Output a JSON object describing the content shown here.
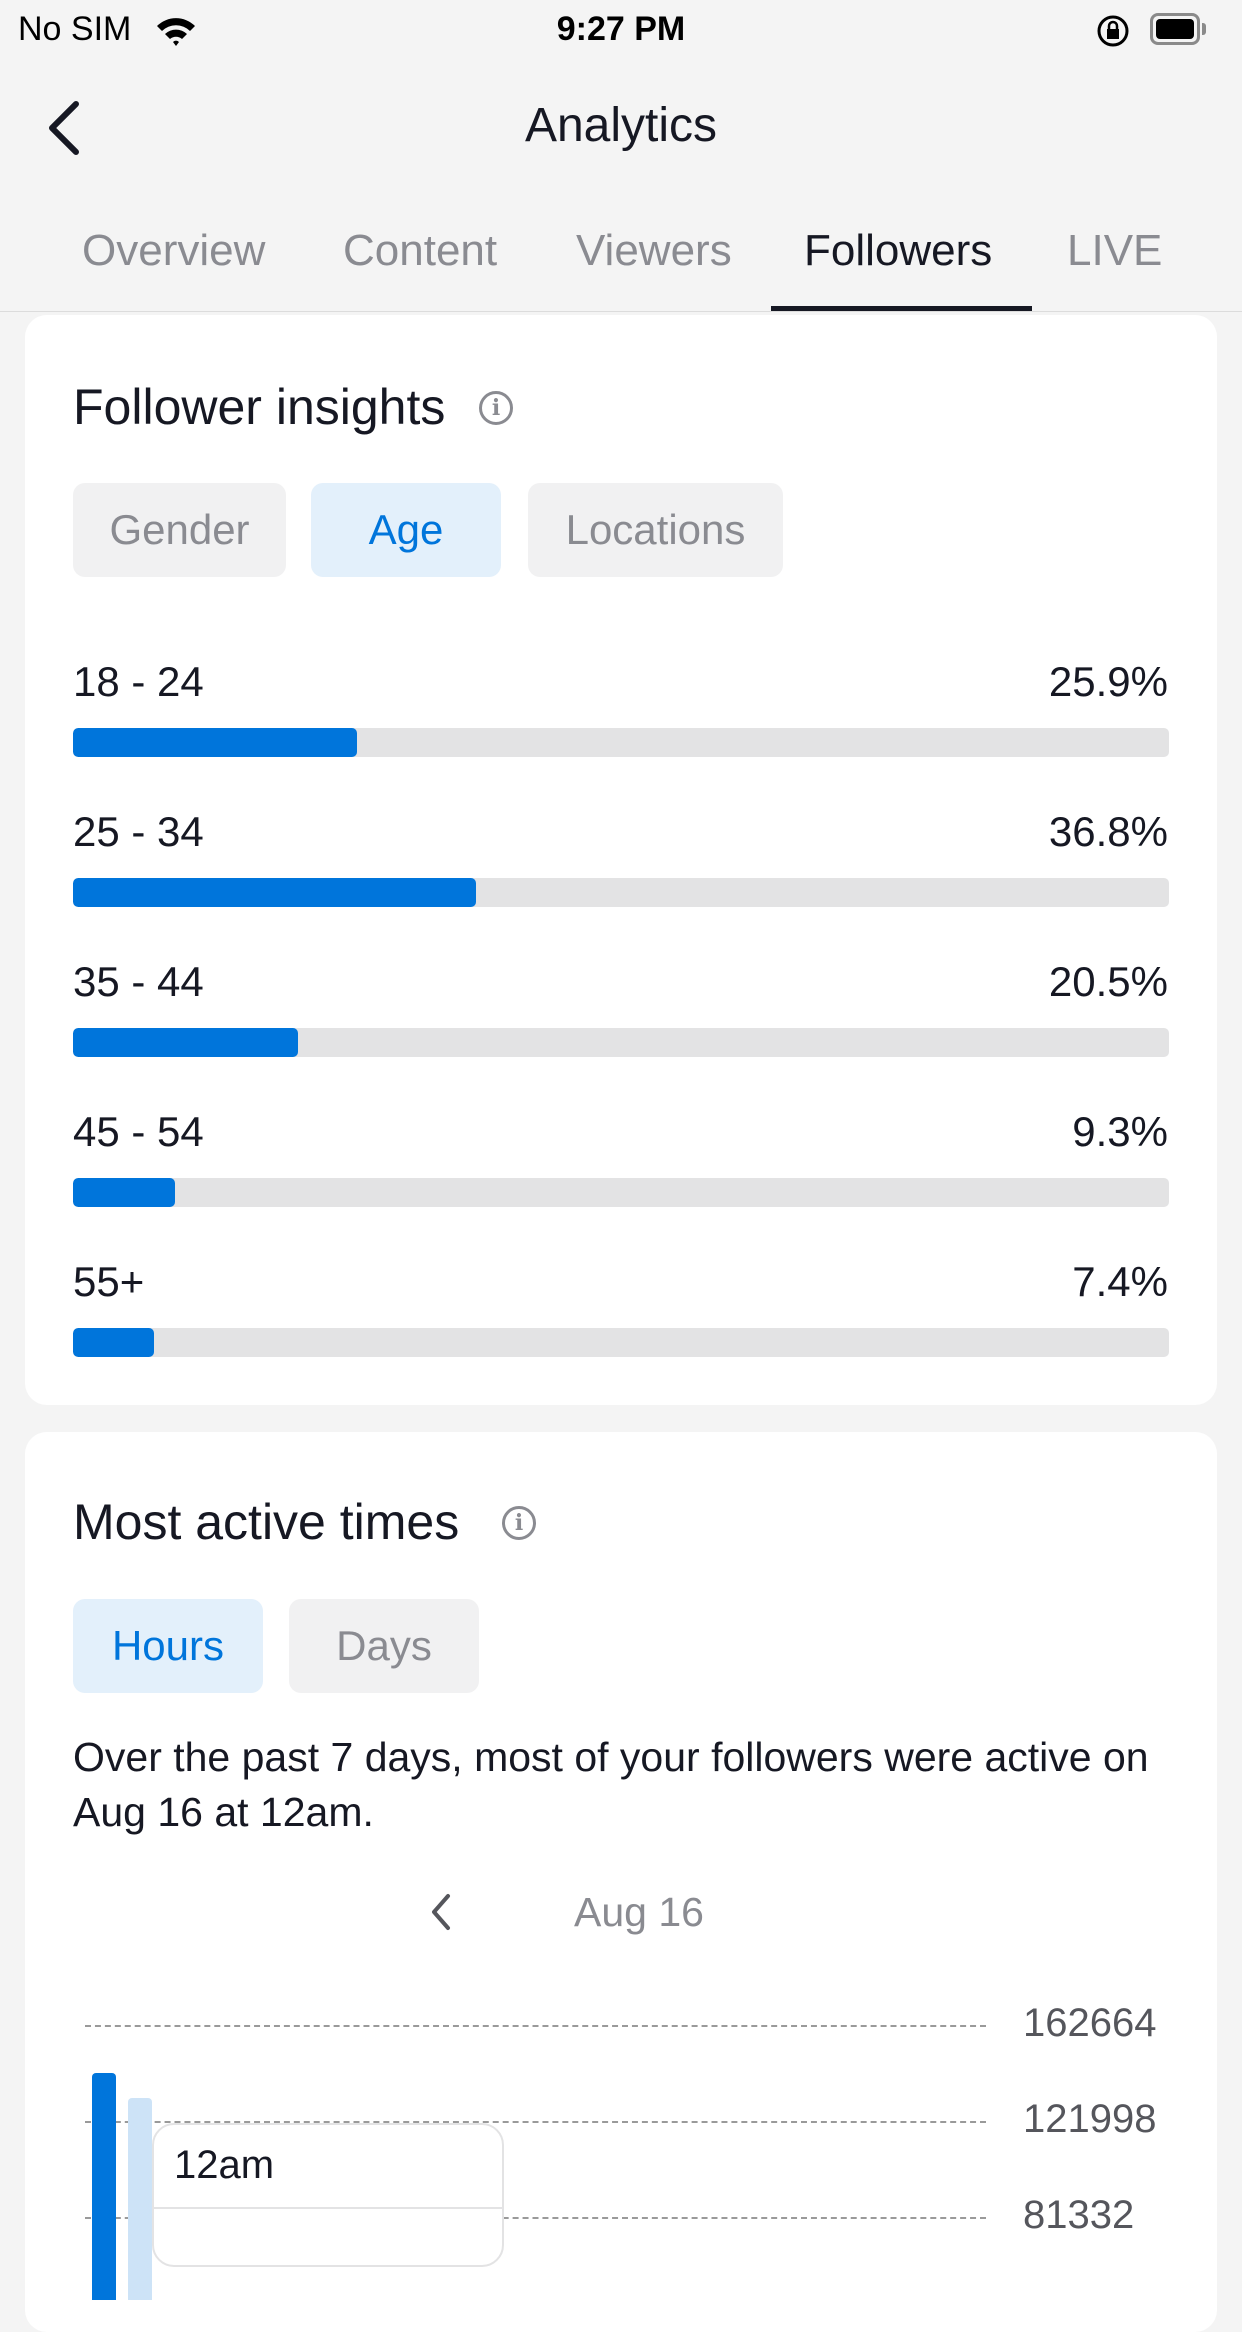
{
  "status_bar": {
    "carrier": "No SIM",
    "time": "9:27 PM",
    "icons": [
      "wifi-icon",
      "orientation-lock-icon",
      "battery-icon"
    ]
  },
  "header": {
    "title": "Analytics",
    "back_icon": "chevron-left-icon"
  },
  "tabs": [
    {
      "label": "Overview"
    },
    {
      "label": "Content"
    },
    {
      "label": "Viewers"
    },
    {
      "label": "Followers",
      "active": true
    },
    {
      "label": "LIVE"
    }
  ],
  "follower_insights": {
    "title": "Follower insights",
    "filters": [
      {
        "label": "Gender"
      },
      {
        "label": "Age",
        "selected": true
      },
      {
        "label": "Locations"
      }
    ],
    "rows": [
      {
        "label": "18 - 24",
        "value": "25.9%",
        "percent": 25.9
      },
      {
        "label": "25 - 34",
        "value": "36.8%",
        "percent": 36.8
      },
      {
        "label": "35 - 44",
        "value": "20.5%",
        "percent": 20.5
      },
      {
        "label": "45 - 54",
        "value": "9.3%",
        "percent": 9.3
      },
      {
        "label": "55+",
        "value": "7.4%",
        "percent": 7.4
      }
    ],
    "accent": "#0075db"
  },
  "most_active": {
    "title": "Most active times",
    "filters": [
      {
        "label": "Hours",
        "selected": true
      },
      {
        "label": "Days"
      }
    ],
    "description": "Over the past 7 days, most of your followers were active on Aug 16 at 12am.",
    "date": "Aug 16",
    "tooltip": {
      "label": "12am"
    }
  },
  "chart_data": {
    "type": "bar",
    "y_ticks": [
      "162664",
      "121998",
      "81332"
    ],
    "grid": true,
    "categories": [
      "12am"
    ],
    "series": [
      {
        "values": [
          142300
        ],
        "color": "#0075db"
      },
      {
        "values": [
          131700
        ],
        "color": "#cde3f7"
      }
    ]
  }
}
